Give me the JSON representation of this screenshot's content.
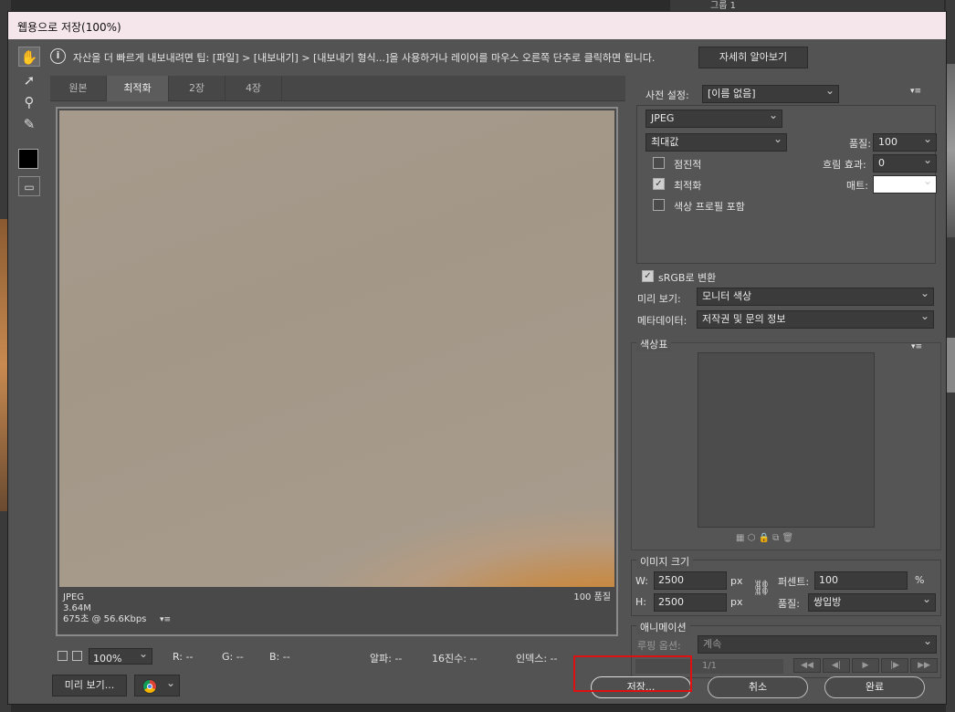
{
  "window": {
    "title": "웹용으로 저장(100%)"
  },
  "info": {
    "tip": "자산을 더 빠르게 내보내려면 팁: [파일] > [내보내기] > [내보내기 형식...]을 사용하거나 레이어를 마우스 오른쪽 단추로 클릭하면 됩니다.",
    "learn_more": "자세히 알아보기"
  },
  "tabs": [
    "원본",
    "최적화",
    "2장",
    "4장"
  ],
  "preview": {
    "format": "JPEG",
    "size": "3.64M",
    "time": "675초 @ 56.6Kbps",
    "quality": "100 품질"
  },
  "status": {
    "zoom": "100%",
    "r": "R: --",
    "g": "G: --",
    "b": "B: --",
    "alpha": "알파: --",
    "hex": "16진수: --",
    "index": "인덱스: --"
  },
  "bottom_left": {
    "preview_button": "미리 보기..."
  },
  "settings": {
    "preset_label": "사전 설정:",
    "preset_value": "[이름 없음]",
    "format": "JPEG",
    "compression": "최대값",
    "quality_label": "품질:",
    "quality_value": "100",
    "progressive": "점진적",
    "blur_label": "흐림 효과:",
    "blur_value": "0",
    "optimized": "최적화",
    "matte_label": "매트:",
    "embed_profile": "색상 프로필 포함"
  },
  "color": {
    "convert_srgb": "sRGB로 변환",
    "preview_label": "미리 보기:",
    "preview_value": "모니터 색상",
    "metadata_label": "메타데이터:",
    "metadata_value": "저작권 및 문의 정보"
  },
  "color_table": {
    "title": "색상표"
  },
  "image_size": {
    "title": "이미지 크기",
    "w_label": "W:",
    "w_value": "2500",
    "h_label": "H:",
    "h_value": "2500",
    "unit": "px",
    "percent_label": "퍼센트:",
    "percent_value": "100",
    "percent_unit": "%",
    "quality_label": "품질:",
    "quality_value": "쌍입방"
  },
  "animation": {
    "title": "애니메이션",
    "loop_label": "루핑 옵션:",
    "loop_value": "계속",
    "frame": "1/1"
  },
  "buttons": {
    "save": "저장...",
    "cancel": "취소",
    "done": "완료"
  },
  "background": {
    "layer_label": "그룹 1"
  }
}
